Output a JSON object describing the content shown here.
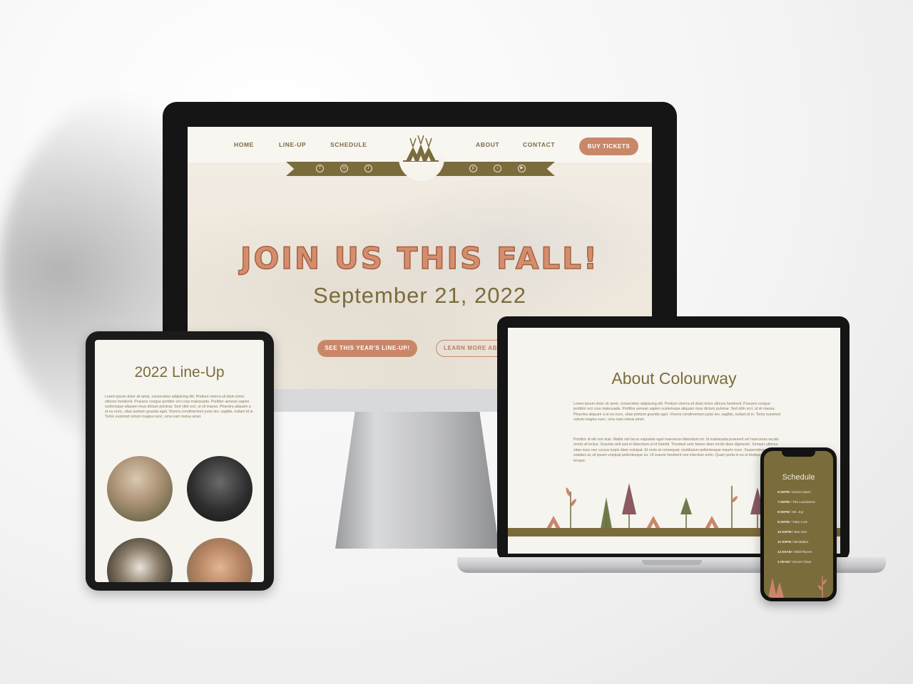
{
  "desktop": {
    "nav": {
      "home": "HOME",
      "lineup": "LINE-UP",
      "schedule": "SCHEDULE",
      "about": "ABOUT",
      "contact": "CONTACT",
      "buy": "BUY TICKETS"
    },
    "hero": {
      "title": "JOIN US THIS FALL!",
      "date": "September 21, 2022",
      "btn_lineup": "SEE THIS YEAR'S LINE-UP!",
      "btn_learn": "LEARN MORE ABOUT US"
    }
  },
  "tablet": {
    "title": "2022 Line-Up",
    "body": "Lorem ipsum dolor sit amet, consectetur adipiscing elit. Pretium viverra sit diam tortor ultrices hendrerit. Posuere congue porttitor orci cras malesuada. Porttitor aenean sapien scelerisque aliquam risus dictum pulvinar. Sed nibh orci, ut sit massa. Pharetra aliquam a ut eu nunc, vitae pretium gravida eget. Viverra condimentum justo leo, sagittis, nullam id in. Tortor euismod rutrum magna nunc, urna nam metus amet."
  },
  "laptop": {
    "title": "About Colourway",
    "para1": "Lorem ipsum dolor sit amet, consectetur adipiscing elit. Pretium viverra sit diam tortor ultrices hendrerit. Posuere congue porttitor orci cras malesuada. Porttitor aenean sapien scelerisque aliquam risus dictum pulvinar. Sed nibh orci, ut sit massa. Pharetra aliquam a ut eu nunc, vitae pretium gravida eget. Viverra condimentum justo leo, sagittis, nullam id in. Tortor euismod rutrum magna nunc, urna nam metus amet.",
    "para2": "Porttitor id elit non duis. Mattis nisl lacus vulputate eget maecenas bibendum mi. Id malesuada praesent vel maecenas iaculis morbi sit lectus. Gravida velit sed et bibendum ut id blandit. Tincidunt sem fames diam morbi diam dignissim. Semper ultrices vitae nunc nec cursus turpis diam volutpat. Et enim at consequat, vestibulum pellentesque mauris nunc. Suspendisse duis sodales ac sit ipsum volutpat pellentesque eu. Ut mauris hendrerit non interdum enim. Quam porta in eu et tristique sagittis tempor."
  },
  "phone": {
    "title": "Schedule",
    "rows": [
      {
        "time": "6:00PM",
        "event": "Doors Open"
      },
      {
        "time": "7:00PM",
        "event": "The Lumineers"
      },
      {
        "time": "8:00PM",
        "event": "Mt. Joy"
      },
      {
        "time": "9:00PM",
        "event": "Yoke Lore"
      },
      {
        "time": "10:00PM",
        "event": "Bon Iver"
      },
      {
        "time": "11:00PM",
        "event": "Birdtalker"
      },
      {
        "time": "12:00AM",
        "event": "Wild Rivers"
      },
      {
        "time": "1:00AM",
        "event": "Doors Close"
      }
    ]
  },
  "colors": {
    "olive": "#7b6c3c",
    "terracotta": "#c9876a",
    "cream": "#f6f4ef",
    "plum": "#8a5a60",
    "green": "#6e7a4a"
  },
  "icons": [
    "facebook-icon",
    "instagram-icon",
    "twitter-icon",
    "pinterest-icon",
    "tiktok-icon",
    "youtube-icon",
    "teepee-logo-icon"
  ]
}
